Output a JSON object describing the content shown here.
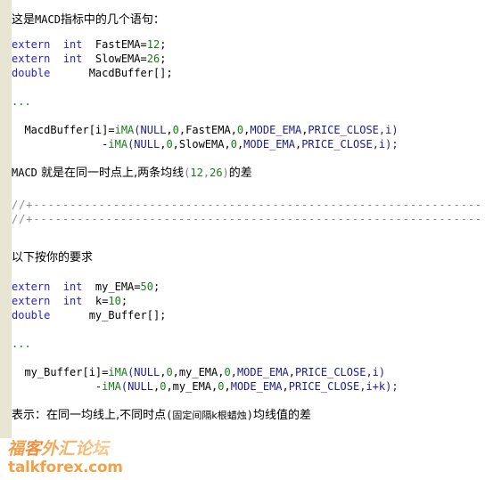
{
  "page": {
    "background_color": "#ffffff",
    "gutter_color": "#e9e5d3"
  },
  "colors": {
    "keyword": "#2424cc",
    "number": "#167a16",
    "function": "#167a16",
    "constant": "#1b1b8f",
    "comment": "#8a8a8a",
    "text": "#000000"
  },
  "intro": {
    "prefix": "这是",
    "mono": "MACD",
    "suffix": "指标中的几个语句："
  },
  "block1": {
    "decl1": {
      "kw": "extern  int",
      "name": "  FastEMA=",
      "num": "12",
      "end": ";"
    },
    "decl2": {
      "kw": "extern  int",
      "name": "  SlowEMA=",
      "num": "26",
      "end": ";"
    },
    "decl3": {
      "kw": "double",
      "name": "      MacdBuffer[];"
    },
    "ellipsis": "...",
    "body_line1": {
      "lhs": "  MacdBuffer[i]=",
      "fn": "iMA",
      "p1": "(",
      "c1": "NULL",
      "comma1": ",",
      "zero1": "0",
      "comma2": ",FastEMA,",
      "zero2": "0",
      "comma3": ",",
      "c2": "MODE_EMA",
      "comma4": ",",
      "c3": "PRICE_CLOSE",
      "tail": ",i)"
    },
    "body_line2": {
      "lhs": "              -",
      "fn": "iMA",
      "p1": "(",
      "c1": "NULL",
      "comma1": ",",
      "zero1": "0",
      "comma2": ",SlowEMA,",
      "zero2": "0",
      "comma3": ",",
      "c2": "MODE_EMA",
      "comma4": ",",
      "c3": "PRICE_CLOSE",
      "tail": ",i);"
    }
  },
  "explain1": {
    "mono": "MACD",
    "text1": " 就是在同一时点上,两条均线",
    "paren_open": "(",
    "n1": "12",
    "paren_comma": ",",
    "n2": "26",
    "paren_close": ")",
    "text2": "的差"
  },
  "separator": {
    "line1": "//+--------------------------------------------------------------",
    "line2": "//+--------------------------------------------------------------"
  },
  "heading2": "以下按你的要求",
  "block2": {
    "decl1": {
      "kw": "extern  int",
      "name": "  my_EMA=",
      "num": "50",
      "end": ";"
    },
    "decl2": {
      "kw": "extern  int",
      "name": "  k=",
      "num": "10",
      "end": ";"
    },
    "decl3": {
      "kw": "double",
      "name": "      my_Buffer[];"
    },
    "ellipsis": "...",
    "body_line1": {
      "lhs": "  my_Buffer[i]=",
      "fn": "iMA",
      "p1": "(",
      "c1": "NULL",
      "comma1": ",",
      "zero1": "0",
      "comma2": ",my_EMA,",
      "zero2": "0",
      "comma3": ",",
      "c2": "MODE_EMA",
      "comma4": ",",
      "c3": "PRICE_CLOSE",
      "tail": ",i)"
    },
    "body_line2": {
      "lhs": "             -",
      "fn": "iMA",
      "p1": "(",
      "c1": "NULL",
      "comma1": ",",
      "zero1": "0",
      "comma2": ",my_EMA,",
      "zero2": "0",
      "comma3": ",",
      "c2": "MODE_EMA",
      "comma4": ",",
      "c3": "PRICE_CLOSE",
      "tail": ",i+k);"
    }
  },
  "explain2": {
    "text1": "表示：在同一均线上,不同时点",
    "paren_open": "(",
    "inner": "固定间隔k根蜡烛",
    "paren_close": ")",
    "text2": "均线值的差"
  },
  "watermark": {
    "chars": [
      "福",
      "客",
      "外",
      "汇",
      "论",
      "坛"
    ],
    "char_colors": [
      "#f0a04a",
      "#ef8f3e",
      "#f2a955",
      "#f4b469",
      "#f6bc7a",
      "#f8c78d"
    ],
    "url": "talkforex.com",
    "url_color": "#f0a24a"
  }
}
